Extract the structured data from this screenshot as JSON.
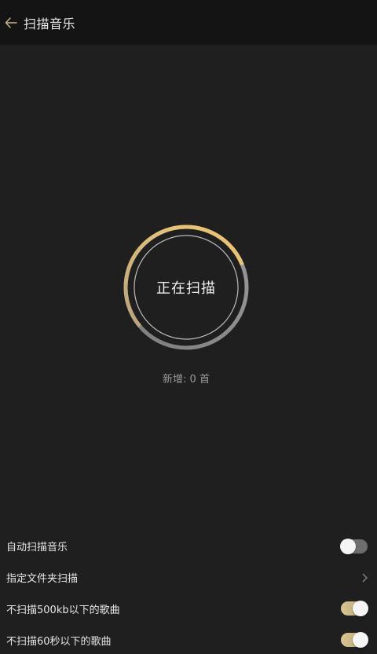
{
  "header": {
    "title": "扫描音乐",
    "back_icon": "arrow-left-icon"
  },
  "scan": {
    "status": "正在扫描",
    "added_text": "新增: 0 首",
    "progress": 0.55,
    "colors": {
      "gold": "#e9c27a",
      "grey": "#8d8d8d",
      "inner_ring": "#bdbdbd"
    }
  },
  "settings": {
    "items": [
      {
        "label": "自动扫描音乐",
        "control": "toggle",
        "on": false
      },
      {
        "label": "指定文件夹扫描",
        "control": "chevron"
      },
      {
        "label": "不扫描500kb以下的歌曲",
        "control": "toggle",
        "on": true
      },
      {
        "label": "不扫描60秒以下的歌曲",
        "control": "toggle",
        "on": true
      }
    ]
  },
  "colors": {
    "background": "#1f1f1f",
    "header_bg": "#141414",
    "accent_gold": "#d8c592"
  }
}
